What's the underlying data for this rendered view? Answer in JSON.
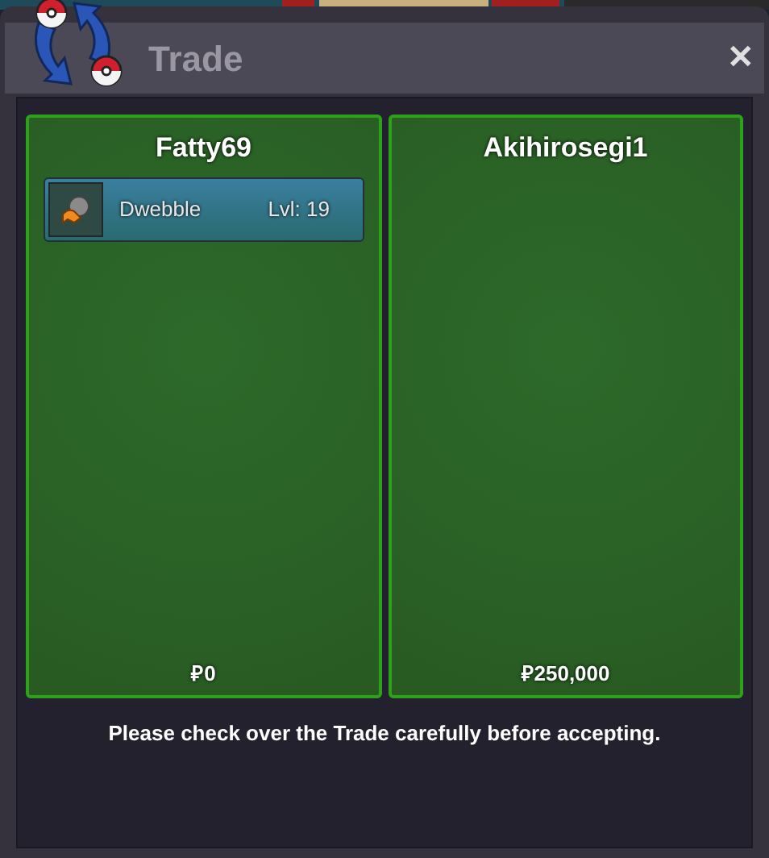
{
  "window": {
    "title": "Trade",
    "close": "✕"
  },
  "traders": [
    {
      "name": "Fatty69",
      "items": [
        {
          "name": "Dwebble",
          "level": "Lvl: 19"
        }
      ],
      "money": "₽0"
    },
    {
      "name": "Akihirosegi1",
      "money": "₽250,000"
    }
  ],
  "message": "Please check over the Trade carefully before accepting."
}
